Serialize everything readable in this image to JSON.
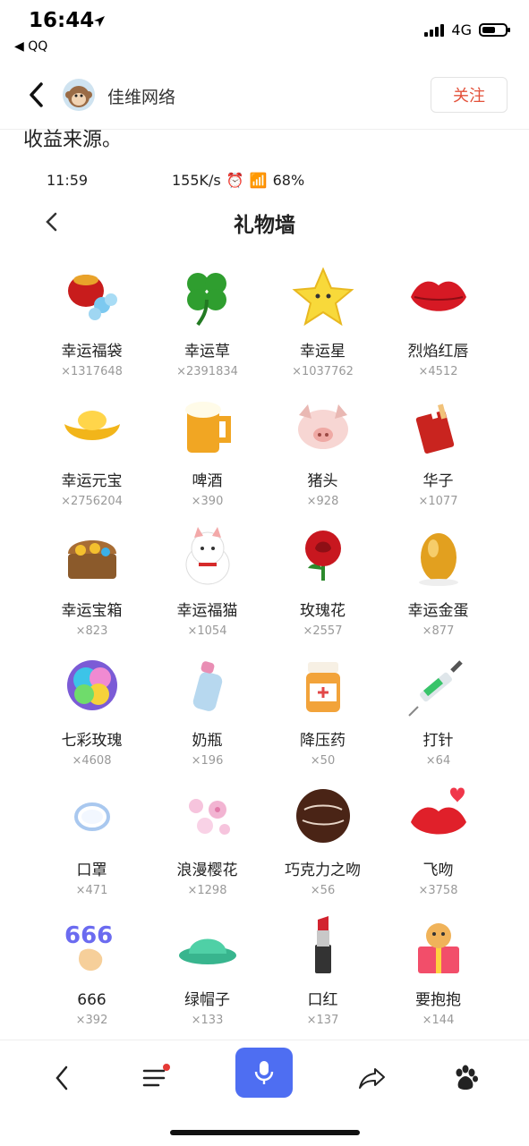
{
  "status_bar": {
    "time": "16:44",
    "back_app": "◀ QQ",
    "network": "4G"
  },
  "header": {
    "author": "佳维网络",
    "follow_label": "关注"
  },
  "article": {
    "text": "收益来源。"
  },
  "embedded": {
    "status": {
      "time": "11:59",
      "speed": "155K/s",
      "battery": "68%"
    },
    "title": "礼物墙",
    "gifts": [
      {
        "name": "幸运福袋",
        "count": "×1317648",
        "icon": "lucky-bag-icon"
      },
      {
        "name": "幸运草",
        "count": "×2391834",
        "icon": "clover-icon"
      },
      {
        "name": "幸运星",
        "count": "×1037762",
        "icon": "star-icon"
      },
      {
        "name": "烈焰红唇",
        "count": "×4512",
        "icon": "red-lips-icon"
      },
      {
        "name": "幸运元宝",
        "count": "×2756204",
        "icon": "gold-ingot-icon"
      },
      {
        "name": "啤酒",
        "count": "×390",
        "icon": "beer-icon"
      },
      {
        "name": "猪头",
        "count": "×928",
        "icon": "pig-head-icon"
      },
      {
        "name": "华子",
        "count": "×1077",
        "icon": "cigarette-pack-icon"
      },
      {
        "name": "幸运宝箱",
        "count": "×823",
        "icon": "treasure-chest-icon"
      },
      {
        "name": "幸运福猫",
        "count": "×1054",
        "icon": "lucky-cat-icon"
      },
      {
        "name": "玫瑰花",
        "count": "×2557",
        "icon": "rose-icon"
      },
      {
        "name": "幸运金蛋",
        "count": "×877",
        "icon": "golden-egg-icon"
      },
      {
        "name": "七彩玫瑰",
        "count": "×4608",
        "icon": "rainbow-rose-icon"
      },
      {
        "name": "奶瓶",
        "count": "×196",
        "icon": "baby-bottle-icon"
      },
      {
        "name": "降压药",
        "count": "×50",
        "icon": "medicine-bottle-icon"
      },
      {
        "name": "打针",
        "count": "×64",
        "icon": "syringe-icon"
      },
      {
        "name": "口罩",
        "count": "×471",
        "icon": "mask-icon"
      },
      {
        "name": "浪漫樱花",
        "count": "×1298",
        "icon": "cherry-blossom-icon"
      },
      {
        "name": "巧克力之吻",
        "count": "×56",
        "icon": "chocolate-icon"
      },
      {
        "name": "飞吻",
        "count": "×3758",
        "icon": "flying-kiss-icon"
      },
      {
        "name": "666",
        "count": "×392",
        "icon": "six-six-six-icon"
      },
      {
        "name": "绿帽子",
        "count": "×133",
        "icon": "green-hat-icon"
      },
      {
        "name": "口红",
        "count": "×137",
        "icon": "lipstick-icon"
      },
      {
        "name": "要抱抱",
        "count": "×144",
        "icon": "hug-gift-icon"
      }
    ]
  },
  "colors": {
    "follow": "#e3513a",
    "voice_button": "#4e6ef2",
    "notify_dot": "#e53935"
  }
}
